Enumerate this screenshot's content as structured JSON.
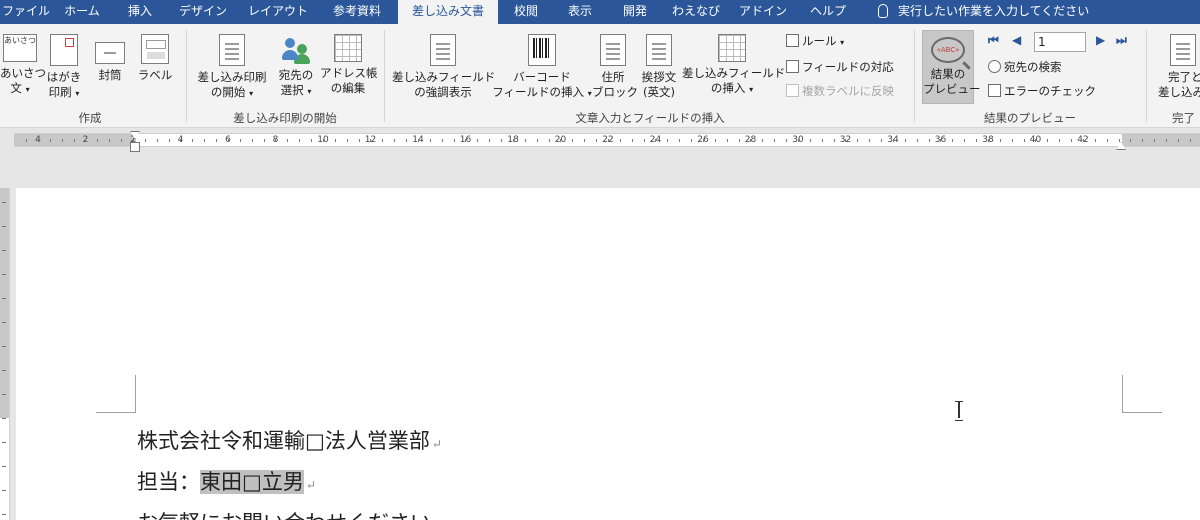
{
  "tabs": [
    {
      "id": "file",
      "label": "ファイル"
    },
    {
      "id": "home",
      "label": "ホーム"
    },
    {
      "id": "insert",
      "label": "挿入"
    },
    {
      "id": "design",
      "label": "デザイン"
    },
    {
      "id": "layout",
      "label": "レイアウト"
    },
    {
      "id": "references",
      "label": "参考資料"
    },
    {
      "id": "mailings",
      "label": "差し込み文書",
      "active": true
    },
    {
      "id": "review",
      "label": "校閲"
    },
    {
      "id": "view",
      "label": "表示"
    },
    {
      "id": "developer",
      "label": "開発"
    },
    {
      "id": "wordnavi",
      "label": "わえなび"
    },
    {
      "id": "addins",
      "label": "アドイン"
    },
    {
      "id": "help",
      "label": "ヘルプ"
    }
  ],
  "tell_me": "実行したい作業を入力してください",
  "ribbon": {
    "create": {
      "label": "作成",
      "greeting": {
        "line1": "あいさつ",
        "line2": "文"
      },
      "greeting_icon_text": "あいさつ",
      "postcard": {
        "line1": "はがき",
        "line2": "印刷"
      },
      "envelope": "封筒",
      "labels": "ラベル"
    },
    "start_merge": {
      "label": "差し込み印刷の開始",
      "start": {
        "line1": "差し込み印刷",
        "line2": "の開始"
      },
      "recipients": {
        "line1": "宛先の",
        "line2": "選択"
      },
      "edit_list": {
        "line1": "アドレス帳",
        "line2": "の編集"
      }
    },
    "write_insert": {
      "label": "文章入力とフィールドの挿入",
      "highlight": {
        "line1": "差し込みフィールド",
        "line2": "の強調表示"
      },
      "barcode": {
        "line1": "バーコード",
        "line2": "フィールドの挿入"
      },
      "address_block": {
        "line1": "住所",
        "line2": "ブロック"
      },
      "greeting_line": {
        "line1": "挨拶文",
        "line2": "(英文)"
      },
      "merge_field": {
        "line1": "差し込みフィールド",
        "line2": "の挿入"
      },
      "rules": "ルール",
      "match_fields": "フィールドの対応",
      "update_labels": "複数ラベルに反映"
    },
    "preview": {
      "label": "結果のプレビュー",
      "preview_results": {
        "line1": "結果の",
        "line2": "プレビュー"
      },
      "preview_icon_text": "«ABC»",
      "record": "1",
      "find_recipient": "宛先の検索",
      "check_errors": "エラーのチェック"
    },
    "finish": {
      "label": "完了",
      "finish_merge": {
        "line1": "完了と",
        "line2": "差し込み"
      }
    }
  },
  "ruler": {
    "numbers": [
      "4",
      "2",
      "2",
      "4",
      "6",
      "8",
      "10",
      "12",
      "14",
      "16",
      "18",
      "20",
      "22",
      "24",
      "26",
      "28",
      "30",
      "32",
      "34",
      "36",
      "38",
      "40",
      "42"
    ]
  },
  "document": {
    "line1": "株式会社令和運輸□法人営業部",
    "line2_prefix": "担当：",
    "line2_field": "東田□立男",
    "line3": "お気軽にお問い合わせください"
  },
  "paragraph_mark": "↵"
}
